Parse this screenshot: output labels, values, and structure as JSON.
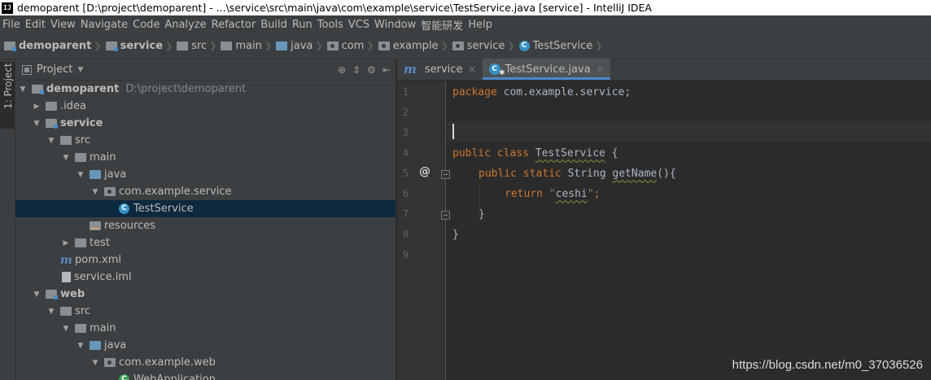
{
  "window": {
    "title": "demoparent [D:\\project\\demoparent] - ...\\service\\src\\main\\java\\com\\example\\service\\TestService.java [service] - IntelliJ IDEA",
    "app_icon_text": "IJ"
  },
  "menu": [
    "File",
    "Edit",
    "View",
    "Navigate",
    "Code",
    "Analyze",
    "Refactor",
    "Build",
    "Run",
    "Tools",
    "VCS",
    "Window",
    "智能研发",
    "Help"
  ],
  "breadcrumb": [
    "demoparent",
    "service",
    "src",
    "main",
    "java",
    "com",
    "example",
    "service",
    "TestService"
  ],
  "stripe": {
    "project_tab": "1: Project"
  },
  "project_panel": {
    "title": "Project",
    "tree": [
      {
        "label": "demoparent",
        "path": "D:\\project\\demoparent"
      },
      {
        "label": ".idea"
      },
      {
        "label": "service"
      },
      {
        "label": "src"
      },
      {
        "label": "main"
      },
      {
        "label": "java"
      },
      {
        "label": "com.example.service"
      },
      {
        "label": "TestService"
      },
      {
        "label": "resources"
      },
      {
        "label": "test"
      },
      {
        "label": "pom.xml"
      },
      {
        "label": "service.iml"
      },
      {
        "label": "web"
      },
      {
        "label": "src"
      },
      {
        "label": "main"
      },
      {
        "label": "java"
      },
      {
        "label": "com.example.web"
      },
      {
        "label": "WebApplication"
      }
    ]
  },
  "editor": {
    "tabs": [
      {
        "label": "service",
        "active": false
      },
      {
        "label": "TestService.java",
        "active": true
      }
    ],
    "line_numbers": [
      "1",
      "2",
      "3",
      "4",
      "5",
      "6",
      "7",
      "8",
      "9"
    ],
    "code": {
      "l1_kw": "package",
      "l1_rest": " com.example.service;",
      "l4_kw": "public class",
      "l4_name": "TestService",
      "l4_rest": " {",
      "l5_kw": "public static",
      "l5_type": " String ",
      "l5_name": "getName",
      "l5_rest": "(){",
      "l6_kw": "return",
      "l6_str_open": " \"",
      "l6_str": "ceshi",
      "l6_str_close": "\"",
      "l6_semi": ";",
      "l7": "}",
      "l8": "}"
    },
    "current_line": 3
  },
  "watermark": "https://blog.csdn.net/m0_37036526"
}
